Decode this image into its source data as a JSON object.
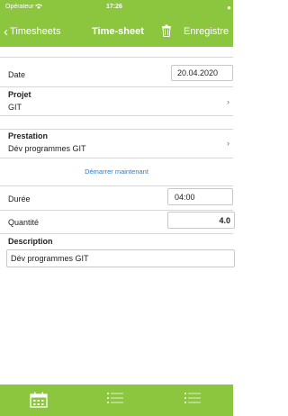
{
  "status": {
    "carrier": "Opérateur",
    "time": "17:26"
  },
  "nav": {
    "back_label": "Timesheets",
    "title": "Time-sheet",
    "save_label": "Enregistre"
  },
  "form": {
    "date": {
      "label": "Date",
      "value": "20.04.2020"
    },
    "projet": {
      "label": "Projet",
      "value": "GIT"
    },
    "prestation": {
      "label": "Prestation",
      "value": "Dév programmes GIT"
    },
    "start_link": "Démarrer maintenant",
    "duree": {
      "label": "Durée",
      "value": "04:00"
    },
    "quantite": {
      "label": "Quantité",
      "value": "4.0"
    },
    "description": {
      "label": "Description",
      "value": "Dév programmes GIT"
    }
  },
  "tabbar": {
    "tabs": [
      {
        "icon": "calendar-icon"
      },
      {
        "icon": "list-icon"
      },
      {
        "icon": "list-icon"
      }
    ]
  },
  "colors": {
    "accent": "#8cc63f",
    "link": "#2a7bd6"
  }
}
